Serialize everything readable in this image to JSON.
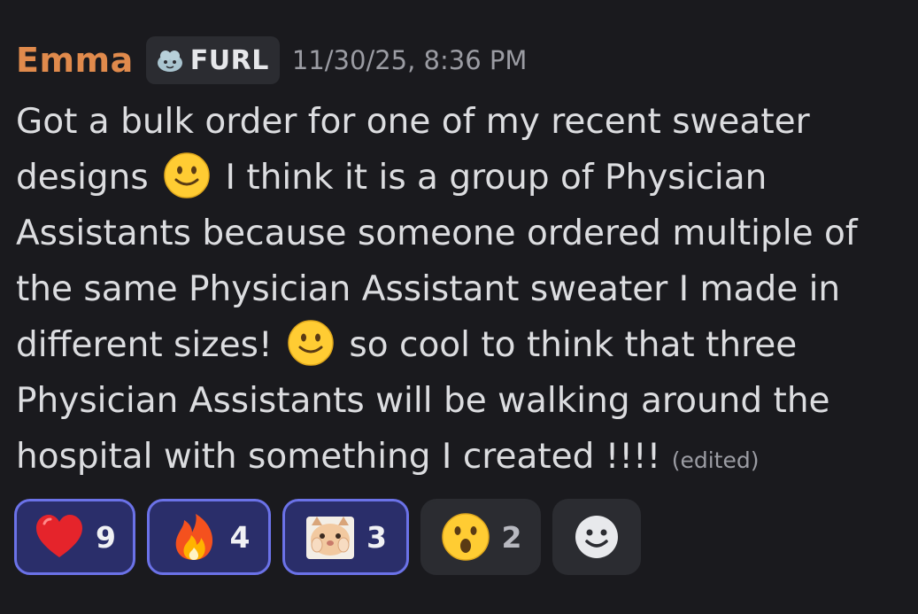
{
  "message": {
    "username": "Emma",
    "tag": {
      "icon": "furl-badge-icon",
      "label": "FURL"
    },
    "timestamp": "11/30/25, 8:36 PM",
    "text_parts": [
      "Got a bulk order for one of my recent sweater designs",
      "I think it is a group of Physician Assistants because someone ordered multiple of the same Physician Assistant sweater I made in different sizes!",
      "so cool to think that three Physician Assistants will be walking around the hospital with something I created !!!!"
    ],
    "inline_emojis": [
      "slightly-smiling-face",
      "slightly-smiling-face"
    ],
    "edited_label": "(edited)"
  },
  "reactions": [
    {
      "emoji": "red-heart",
      "count": "9",
      "active": true
    },
    {
      "emoji": "fire",
      "count": "4",
      "active": true
    },
    {
      "emoji": "hamster-cat",
      "count": "3",
      "active": true
    },
    {
      "emoji": "face-with-open-mouth",
      "count": "2",
      "active": false
    }
  ],
  "add_reaction": {
    "icon": "smiley-add-reaction-icon"
  },
  "colors": {
    "background": "#1a1a1e",
    "username": "#e08a4c",
    "active_reaction_bg": "#2a2e6a",
    "active_reaction_border": "#6b72e8",
    "inactive_reaction_bg": "#2b2c31"
  }
}
